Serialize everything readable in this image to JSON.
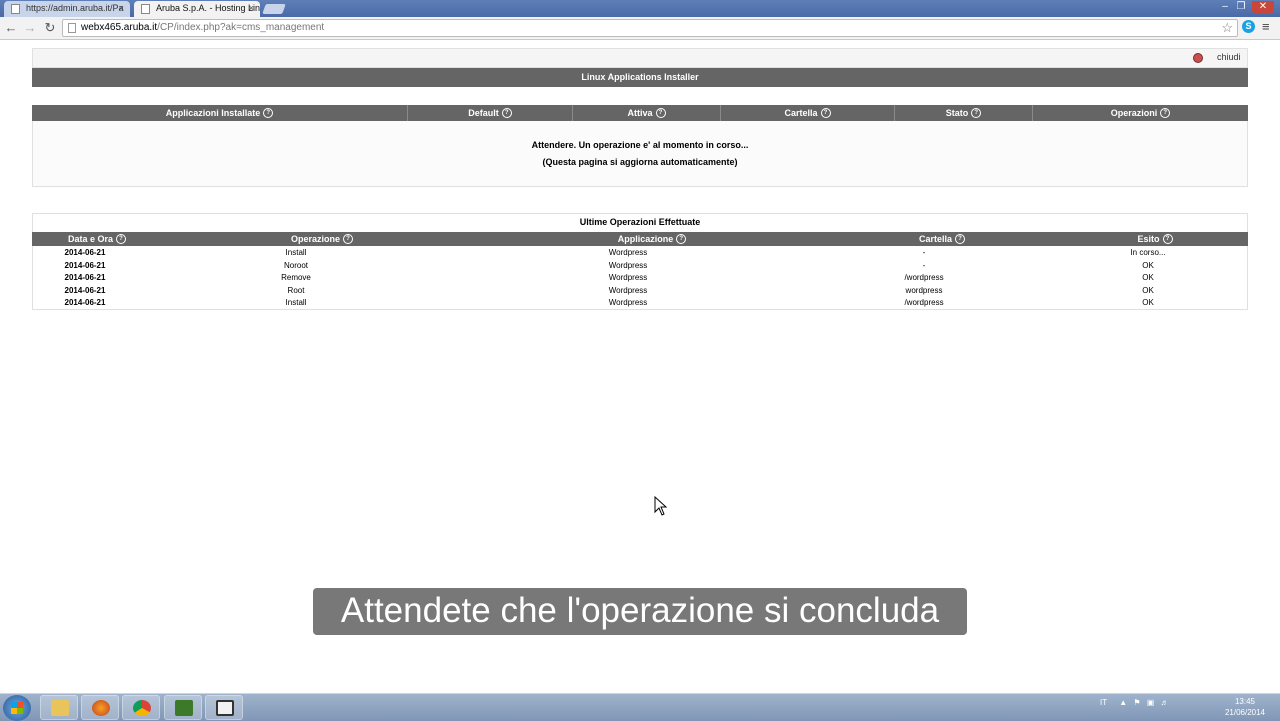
{
  "browser": {
    "tabs": [
      {
        "label": "https://admin.aruba.it/Pa"
      },
      {
        "label": "Aruba S.p.A. - Hosting Lin"
      }
    ],
    "close_tab_glyph": "×",
    "url_host": "webx465.aruba.it",
    "url_path": "/CP/index.php?ak=cms_management"
  },
  "page": {
    "close_label": "chiudi",
    "title": "Linux Applications Installer",
    "apps_table": {
      "headers": [
        "Applicazioni Installate",
        "Default",
        "Attiva",
        "Cartella",
        "Stato",
        "Operazioni"
      ],
      "message_line1": "Attendere. Un operazione e' al momento in corso...",
      "message_line2": "(Questa pagina si aggiorna automaticamente)"
    },
    "ops_table": {
      "title": "Ultime Operazioni Effettuate",
      "headers": [
        "Data e Ora",
        "Operazione",
        "Applicazione",
        "Cartella",
        "Esito"
      ],
      "rows": [
        [
          "2014-06-21",
          "Install",
          "Wordpress",
          "-",
          "In corso..."
        ],
        [
          "2014-06-21",
          "Noroot",
          "Wordpress",
          "-",
          "OK"
        ],
        [
          "2014-06-21",
          "Remove",
          "Wordpress",
          "/wordpress",
          "OK"
        ],
        [
          "2014-06-21",
          "Root",
          "Wordpress",
          "wordpress",
          "OK"
        ],
        [
          "2014-06-21",
          "Install",
          "Wordpress",
          "/wordpress",
          "OK"
        ]
      ]
    }
  },
  "caption": "Attendete che l'operazione si concluda",
  "taskbar": {
    "language": "IT",
    "time": "13:45",
    "date": "21/06/2014",
    "apps": [
      "explorer-icon",
      "firefox-icon",
      "chrome-icon",
      "camtasia-icon",
      "camtasia-recorder-icon"
    ]
  },
  "colors": {
    "header_gray": "#656565",
    "chrome_blue": "#4a6aa8"
  }
}
